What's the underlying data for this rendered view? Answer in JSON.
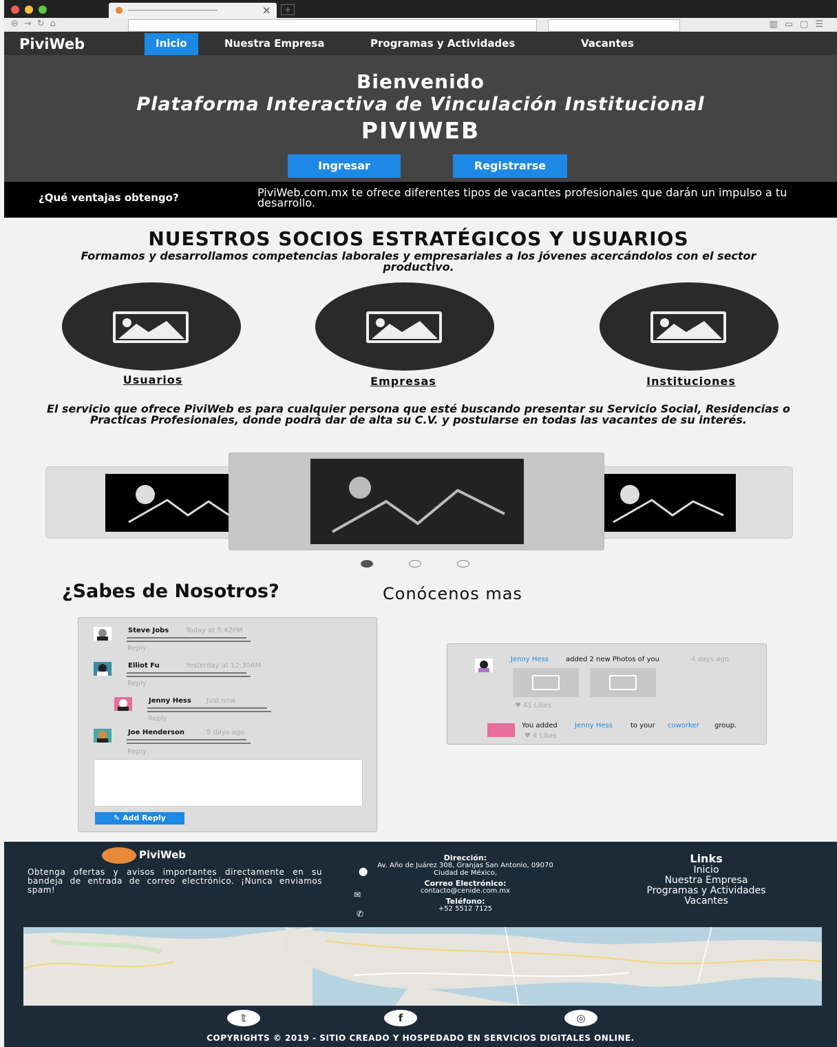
{
  "nav": {
    "brand": "PiviWeb",
    "items": [
      "Inicio",
      "Nuestra Empresa",
      "Programas y Actividades",
      "Vacantes"
    ]
  },
  "hero": {
    "welcome": "Bienvenido",
    "subtitle": "Plataforma Interactiva de Vinculación Institucional",
    "name": "PIVIWEB",
    "login_label": "Ingresar",
    "register_label": "Registrarse"
  },
  "advantages": {
    "question": "¿Qué ventajas obtengo?",
    "answer": "PiviWeb.com.mx te ofrece diferentes tipos de vacantes profesionales que darán un impulso a tu desarrollo."
  },
  "partners": {
    "title": "NUESTROS SOCIOS ESTRATÉGICOS Y USUARIOS",
    "subtitle": "Formamos y desarrollamos competencias laborales y empresariales a los jóvenes acercándolos con el sector productivo.",
    "categories": [
      "Usuarios",
      "Empresas",
      "Instituciones"
    ],
    "service_text": "El servicio que ofrece PiviWeb es para cualquier persona que esté buscando presentar su Servicio Social, Residencias o Practicas Profesionales, donde podrá dar de alta su C.V. y postularse en todas las vacantes de su interés."
  },
  "about": {
    "title": "¿Sabes de Nosotros?",
    "subtitle": "Conócenos mas"
  },
  "comments": [
    {
      "name": "Steve Jobs",
      "time": "Today at 5:42PM",
      "reply": "Reply"
    },
    {
      "name": "Elliot Fu",
      "time": "Yesterday at 12:30AM",
      "reply": "Reply"
    },
    {
      "name": "Jenny Hess",
      "time": "Just now",
      "reply": "Reply"
    },
    {
      "name": "Joe Henderson",
      "time": "5 days ago",
      "reply": "Reply"
    }
  ],
  "add_reply_label": "Add Reply",
  "feed": {
    "user": "Jenny Hess",
    "action": "added 2 new Photos of you",
    "time": "4 days ago",
    "likes1": "41 Likes",
    "event2_pre": "You added",
    "event2_user": "Jenny Hess",
    "event2_mid": "to your",
    "event2_link": "coworker",
    "event2_post": "group.",
    "likes2": "4 Likes"
  },
  "footer": {
    "brand": "PiviWeb",
    "newsletter": "Obtenga ofertas y avisos importantes directamente en su bandeja de entrada de correo electrónico. ¡Nunca enviamos spam!",
    "address_label": "Dirección:",
    "address": "Av. Año de Juárez 308, Granjas San Antonio, 09070 Ciudad de México,",
    "email_label": "Correo Electrónico:",
    "email": "contacto@cenide.com.mx",
    "phone_label": "Teléfono:",
    "phone": "+52 5512 7125",
    "links_title": "Links",
    "links": [
      "Inicio",
      "Nuestra Empresa",
      "Programas y Actividades",
      "Vacantes"
    ],
    "copyright": "COPYRIGHTS © 2019 - SITIO CREADO Y HOSPEDADO EN SERVICIOS DIGITALES ONLINE."
  },
  "colors": {
    "accent": "#1e88e5",
    "nav_bg": "#333333",
    "footer_bg": "#1d2b38"
  }
}
